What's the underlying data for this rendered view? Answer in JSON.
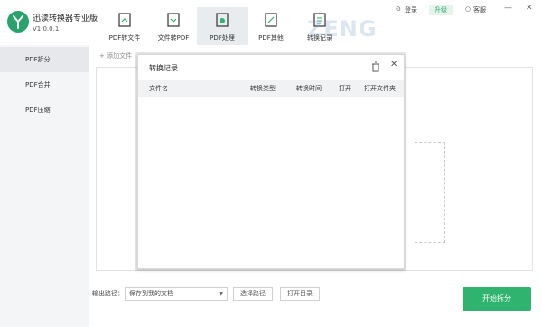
{
  "app": {
    "title": "迅读转换器专业版",
    "version": "V1.0.0.1",
    "accent": "#2fb36f"
  },
  "tabs": [
    {
      "label": "PDF转文件",
      "icon": "pdf-to-file-icon"
    },
    {
      "label": "文件转PDF",
      "icon": "file-to-pdf-icon"
    },
    {
      "label": "PDF处理",
      "icon": "pdf-process-icon"
    },
    {
      "label": "PDF其他",
      "icon": "pdf-other-icon"
    },
    {
      "label": "转换记录",
      "icon": "history-icon"
    }
  ],
  "top_right": {
    "login": "登录",
    "upgrade": "升级",
    "service": "客服",
    "minimize": "—",
    "close": "✕"
  },
  "sidebar": {
    "items": [
      {
        "label": "PDF拆分"
      },
      {
        "label": "PDF合并"
      },
      {
        "label": "PDF压缩"
      }
    ]
  },
  "main": {
    "add_file": "+ 添加文件",
    "output_label": "输出路径：",
    "output_value": "保存到我的文档",
    "choose_path": "选择路径",
    "open_dir": "打开目录",
    "start": "开始拆分"
  },
  "dialog": {
    "title": "转换记录",
    "columns": [
      "文件名",
      "转换类型",
      "转换时间",
      "打开",
      "打开文件夹"
    ],
    "close": "✕"
  }
}
